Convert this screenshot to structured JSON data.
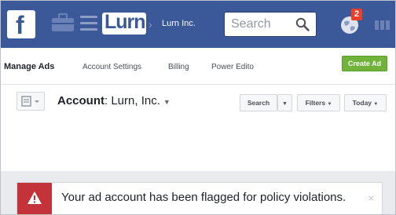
{
  "topbar": {
    "logo_letter": "f",
    "brand": "Lurn",
    "crumb_arrow": "›",
    "account_name": "Lurn Inc.",
    "search_placeholder": "Search",
    "notification_count": "2",
    "icons": [
      "facebook-logo",
      "briefcase-icon",
      "hamburger-icon",
      "search-icon",
      "globe-icon",
      "more-icon"
    ]
  },
  "nav": {
    "items": [
      "Manage Ads",
      "Account Settings",
      "Billing",
      "Power Edito"
    ],
    "create_label": "Create Ad"
  },
  "account": {
    "label": "Account",
    "name": "Lurn, Inc.",
    "search_label": "Search",
    "filters_label": "Filters",
    "date_label": "Today"
  },
  "alert": {
    "message": "Your ad account has been flagged for policy violations.",
    "close": "×"
  },
  "colors": {
    "topbar": "#3b5998",
    "create_button": "#6fb33b",
    "alert_icon": "#c43339",
    "badge": "#f03d25"
  }
}
